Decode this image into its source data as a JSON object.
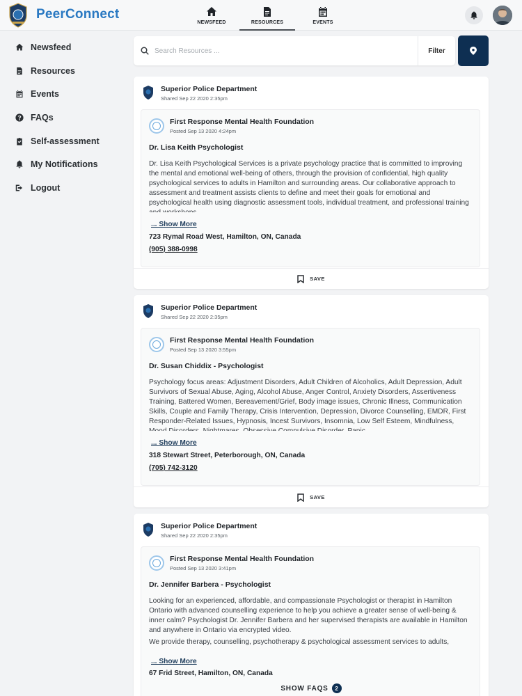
{
  "header": {
    "brand": "PeerConnect",
    "nav": [
      {
        "label": "NEWSFEED",
        "icon": "home-icon"
      },
      {
        "label": "RESOURCES",
        "icon": "document-icon"
      },
      {
        "label": "EVENTS",
        "icon": "calendar-icon"
      }
    ],
    "active_tab": "RESOURCES"
  },
  "sidebar": {
    "items": [
      {
        "label": "Newsfeed",
        "icon": "home-icon"
      },
      {
        "label": "Resources",
        "icon": "document-icon"
      },
      {
        "label": "Events",
        "icon": "calendar-icon"
      },
      {
        "label": "FAQs",
        "icon": "question-icon"
      },
      {
        "label": "Self-assessment",
        "icon": "clipboard-icon"
      },
      {
        "label": "My Notifications",
        "icon": "bell-icon"
      },
      {
        "label": "Logout",
        "icon": "logout-icon"
      }
    ]
  },
  "search": {
    "placeholder": "Search Resources ...",
    "value": "",
    "filter_label": "Filter"
  },
  "cards": [
    {
      "sharer": "Superior Police Department",
      "shared": "Shared Sep 22 2020 2:35pm",
      "org": "First Response Mental Health Foundation",
      "posted": "Posted Sep 13 2020 4:24pm",
      "title": "Dr. Lisa Keith Psychologist",
      "body": "Dr. Lisa Keith Psychological Services is a private psychology practice that is committed to improving the mental and emotional well-being of others, through the provision of confidential, high quality psychological services to adults in Hamilton and surrounding areas. Our collaborative approach to assessment and treatment assists clients to define and meet their goals for emotional and psychological health using diagnostic assessment tools, individual treatment, and professional training and workshops.",
      "show_more": "... Show More",
      "address": "723 Rymal Road West, Hamilton, ON, Canada",
      "phone": "(905) 388-0998",
      "save": "SAVE"
    },
    {
      "sharer": "Superior Police Department",
      "shared": "Shared Sep 22 2020 2:35pm",
      "org": "First Response Mental Health Foundation",
      "posted": "Posted Sep 13 2020 3:55pm",
      "title": "Dr. Susan Chiddix - Psychologist",
      "body": "Psychology focus areas: Adjustment Disorders, Adult Children of Alcoholics, Adult Depression, Adult Survivors of Sexual Abuse, Aging, Alcohol Abuse, Anger Control, Anxiety Disorders, Assertiveness Training, Battered Women, Bereavement/Grief, Body image issues, Chronic Illness, Communication Skills, Couple and Family Therapy, Crisis Intervention, Depression, Divorce Counselling, EMDR, First Responder-Related Issues, Hypnosis, Incest Survivors, Insomnia, Low Self Esteem, Mindfulness, Mood Disorders, Nightmares, Obsessive Compulsive Disorder, Panic",
      "show_more": "... Show More",
      "address": "318 Stewart Street, Peterborough, ON, Canada",
      "phone": "(705) 742-3120",
      "save": "SAVE"
    },
    {
      "sharer": "Superior Police Department",
      "shared": "Shared Sep 22 2020 2:35pm",
      "org": "First Response Mental Health Foundation",
      "posted": "Posted Sep 13 2020 3:41pm",
      "title": "Dr. Jennifer Barbera - Psychologist",
      "body": "Looking for an experienced, affordable, and compassionate Psychologist or therapist in Hamilton Ontario with advanced counselling experience to help you achieve a greater sense of well-being & inner calm? Psychologist Dr. Jennifer Barbera and her supervised therapists are available in Hamilton and anywhere in Ontario via encrypted video.",
      "body2": "We provide therapy, counselling, psychotherapy & psychological assessment services to adults,",
      "show_more": "... Show More",
      "address": "67 Frid Street, Hamilton, ON, Canada"
    }
  ],
  "faqs": {
    "label": "SHOW FAQS",
    "count": "2"
  }
}
